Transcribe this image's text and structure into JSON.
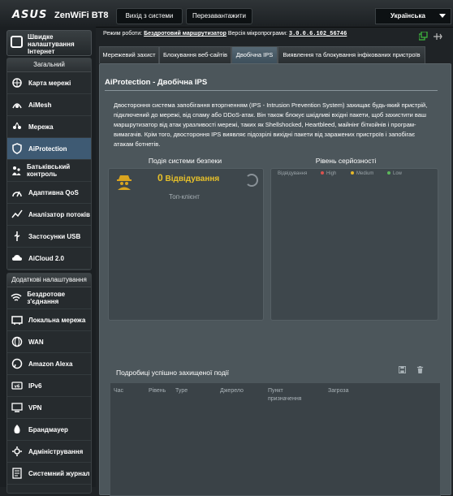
{
  "header": {
    "brand": "ASUS",
    "model": "ZenWiFi BT8",
    "logout_label": "Вихід з системи",
    "reboot_label": "Перезавантажити",
    "language": "Українська"
  },
  "sidebar": {
    "quick_setup": "Швидке налаштування Інтернет",
    "general_head": "Загальний",
    "general_items": [
      {
        "label": "Карта мережі",
        "icon": "network-map-icon"
      },
      {
        "label": "AiMesh",
        "icon": "aimesh-icon"
      },
      {
        "label": "Мережа",
        "icon": "network-icon"
      },
      {
        "label": "AiProtection",
        "icon": "aiprotection-icon"
      },
      {
        "label": "Батьківський контроль",
        "icon": "parental-control-icon"
      },
      {
        "label": "Адаптивна QoS",
        "icon": "qos-icon"
      },
      {
        "label": "Аналізатор потоків",
        "icon": "traffic-analyzer-icon"
      },
      {
        "label": "Застосунки USB",
        "icon": "usb-icon"
      },
      {
        "label": "AiCloud 2.0",
        "icon": "aicloud-icon"
      }
    ],
    "advanced_head": "Додаткові налаштування",
    "advanced_items": [
      {
        "label": "Бездротове з'єднання",
        "icon": "wireless-icon"
      },
      {
        "label": "Локальна мережа",
        "icon": "lan-icon"
      },
      {
        "label": "WAN",
        "icon": "wan-icon"
      },
      {
        "label": "Amazon Alexa",
        "icon": "alexa-icon"
      },
      {
        "label": "IPv6",
        "icon": "ipv6-icon"
      },
      {
        "label": "VPN",
        "icon": "vpn-icon"
      },
      {
        "label": "Брандмауер",
        "icon": "firewall-icon"
      },
      {
        "label": "Адміністрування",
        "icon": "administration-icon"
      },
      {
        "label": "Системний журнал",
        "icon": "system-log-icon"
      }
    ]
  },
  "status": {
    "mode_label": "Режим роботи:",
    "mode_value": "Бездротовий маршрутизатор",
    "fw_label": "Версія мікропрограми:",
    "fw_value": "3.0.0.6.102_56746"
  },
  "tabs": [
    "Мережевий захист",
    "Блокування веб-сайтів",
    "Двобічна IPS",
    "Виявлення та блокування інфікованих пристроїв"
  ],
  "page": {
    "title": "AiProtection - Двобічна IPS",
    "description": "Двостороння система запобігання вторгненням (IPS - Intrusion Prevention System) захищає будь-який пристрій, підключений до мережі, від спаму або DDoS-атак. Він також блокує шкідливі вхідні пакети, щоб захистити ваш маршрутизатор від атак уразливості мережі, таких як Shellshocked, Heartbleed, майнінг біткойнів і програм-вимагачів. Крім того, двостороння IPS виявляє підозрілі вихідні пакети від заражених пристроїв і запобігає атакам ботнетів.",
    "events_head": "Подія системи безпеки",
    "severity_head": "Рівень серйозності",
    "detected_count": "0",
    "detected_label": "Відвідування",
    "top_client": "Топ-клієнт",
    "legend_visits": "Відвідування",
    "legend_high": "High",
    "legend_medium": "Medium",
    "legend_low": "Low",
    "history_head": "Подробиці успішно захищеної події",
    "columns": [
      "Час",
      "Рівень",
      "Type",
      "Джерело",
      "Пункт призначення",
      "Загроза"
    ]
  },
  "colors": {
    "high": "#d9534f",
    "medium": "#e6b82a",
    "low": "#5cb85c",
    "active_tab": "#4f6371",
    "active_item": "#3e5a73"
  }
}
